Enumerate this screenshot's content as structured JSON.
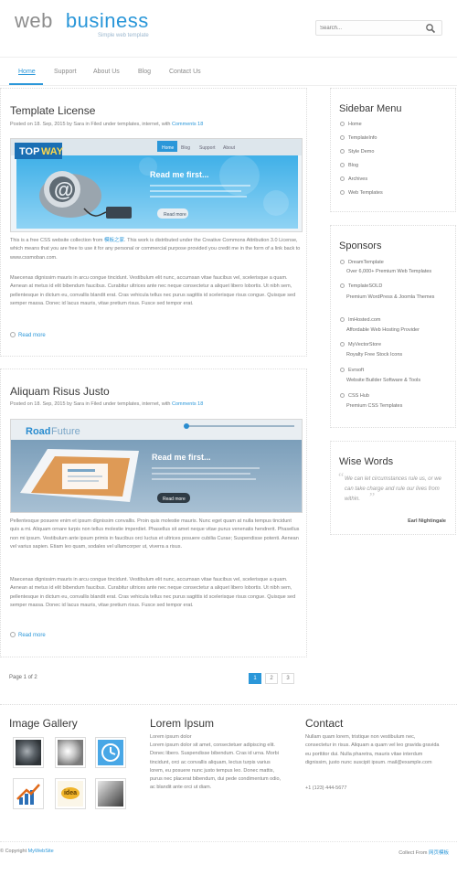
{
  "header": {
    "logo_part1": "web",
    "logo_part2": "business",
    "slogan": "Simple web template",
    "search_placeholder": "Search..."
  },
  "nav": {
    "items": [
      "Home",
      "Support",
      "About Us",
      "Blog",
      "Contact Us"
    ],
    "active": "Home"
  },
  "posts": [
    {
      "title": "Template License",
      "meta_prefix": "Posted on 18. Sep, 2015 by Sara in Filed under templates, internet, with",
      "comments_link": "Comments 18",
      "image": {
        "brand_a": "TOP",
        "brand_b": "WAY",
        "headline": "Read me first...",
        "button": "Read more",
        "tabs": [
          "Home",
          "Blog",
          "Support",
          "About"
        ]
      },
      "p1_before": "This is a free CSS website collection from",
      "p1_link": "模板之家",
      "p1_after": ". This work is distributed under the Creative Commons Attribution 3.0 License, which means that you are free to use it for any personal or commercial purpose provided you credit me in the form of a link back to www.cssmoban.com.",
      "p2": "Maecenas dignissim mauris in arcu congue tincidunt. Vestibulum elit nunc, accumsan vitae faucibus vel, scelerisque a quam. Aenean at metus id elit bibendum faucibus. Curabitur ultrices ante nec neque consectetur a aliquet libero lobortis. Ut nibh sem, pellentesque in dictum eu, convallis blandit erat. Cras vehicula tellus nec purus sagittis id scelerisque risus congue. Quisque sed semper massa. Donec id lacus mauris, vitae pretium risus. Fusce sed tempor erat.",
      "readmore": "Read more"
    },
    {
      "title": "Aliquam Risus Justo",
      "meta_prefix": "Posted on 18. Sep, 2015 by Sara in Filed under templates, internet, with",
      "comments_link": "Comments 18",
      "image": {
        "brand_a": "Road",
        "brand_b": "Future",
        "headline": "Read me first...",
        "button": "Read more"
      },
      "p1": "Pellentesque posuere enim et ipsum dignissim convallis. Proin quis molestie mauris. Nunc eget quam at nulla tempus tincidunt quis a mi. Aliquam ornare turpis non tellus molestie imperdiet. Phasellus sit amet neque vitae purus venenatis hendrerit. Phasellus non mi ipsum. Vestibulum ante ipsum primis in faucibus orci luctus et ultrices posuere cubilia Curae; Suspendisse potenti. Aenean vel varius sapien. Etiam leo quam, sodales vel ullamcorper ut, viverra a risus.",
      "p2": "Maecenas dignissim mauris in arcu congue tincidunt. Vestibulum elit nunc, accumsan vitae faucibus vel, scelerisque a quam. Aenean at metus id elit bibendum faucibus. Curabitur ultrices ante nec neque consectetur a aliquet libero lobortis. Ut nibh sem, pellentesque in dictum eu, convallis blandit erat. Cras vehicula tellus nec purus sagittis id scelerisque risus congue. Quisque sed semper massa. Donec id lacus mauris, vitae pretium risus. Fusce sed tempor erat.",
      "readmore": "Read more"
    }
  ],
  "sidebar": {
    "menu_title": "Sidebar Menu",
    "menu_items": [
      "Home",
      "TemplateInfo",
      "Style Demo",
      "Blog",
      "Archives",
      "Web Templates"
    ],
    "sponsors_title": "Sponsors",
    "sponsors": [
      {
        "name": "DreamTemplate",
        "desc": "Over 6,000+ Premium Web Templates"
      },
      {
        "name": "TemplateSOLD",
        "desc": "Premium WordPress & Joomla Themes"
      },
      {
        "name": "ImHosted.com",
        "desc": "Affordable Web Hosting Provider"
      },
      {
        "name": "MyVectorStore",
        "desc": "Royalty Free Stock Icons"
      },
      {
        "name": "Evrsoft",
        "desc": "Website Builder Software & Tools"
      },
      {
        "name": "CSS Hub",
        "desc": "Premium CSS Templates"
      }
    ],
    "words_title": "Wise Words",
    "quote": "We can let circumstances rule us, or we can take charge and rule our lives from within.",
    "quote_author": "Earl Nightingale"
  },
  "pagination": {
    "label": "Page 1 of 2",
    "pages": [
      "1",
      "2",
      "3"
    ],
    "current": "1"
  },
  "bottom": {
    "gallery_title": "Image Gallery",
    "lorem_title": "Lorem Ipsum",
    "lorem_lead": "Lorem ipsum dolor",
    "lorem_text": "Lorem ipsum dolor sit amet, consectetuer adipiscing elit. Donec libero. Suspendisse bibendum. Cras id urna. Morbi tincidunt, orci ac convallis aliquam, lectus turpis varius lorem, eu posuere nunc justo tempus leo. Donec mattis, purus nec placerat bibendum, dui pede condimentum odio, ac blandit ante orci ut diam.",
    "contact_title": "Contact",
    "contact_text": "Nullam quam lorem, tristique non vestibulum nec, consectetur in risus. Aliquam a quam vel leo gravida gravida eu porttitor dui. Nulla pharetra, mauris vitae interdum dignissim, justo nunc suscipit ipsum. mail@example.com",
    "contact_phone": "+1 (123) 444-5677",
    "idea_label": "idea"
  },
  "footer": {
    "copyright_prefix": "© Copyright",
    "copyright_link": "MyWebSite",
    "collect_prefix": "Collect From",
    "collect_link": "网页模板"
  },
  "colors": {
    "accent": "#2b97d9",
    "text": "#7a7a7a",
    "heading": "#3a3a3a"
  }
}
